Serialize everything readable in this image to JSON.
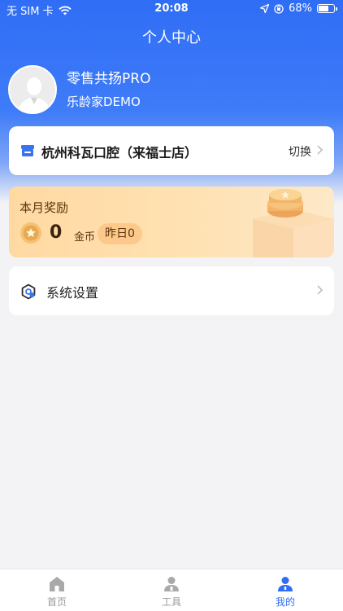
{
  "status_bar": {
    "carrier": "无 SIM 卡",
    "time": "20:08",
    "battery": "68%",
    "battery_level": 0.68
  },
  "header": {
    "title": "个人中心"
  },
  "user": {
    "name": "零售共扬PRO",
    "org": "乐龄家DEMO"
  },
  "store": {
    "name": "杭州科瓦口腔（来福士店）",
    "switch_label": "切换"
  },
  "reward": {
    "title": "本月奖励",
    "coins": "0",
    "coin_unit": "金币",
    "yesterday": "昨日0"
  },
  "settings": {
    "label": "系统设置"
  },
  "tabbar": {
    "home": "首页",
    "tools": "工具",
    "mine": "我的",
    "active": "mine"
  },
  "colors": {
    "primary": "#2f6df6",
    "tab_inactive": "#9a9a9a",
    "reward_text": "#5a3410"
  }
}
